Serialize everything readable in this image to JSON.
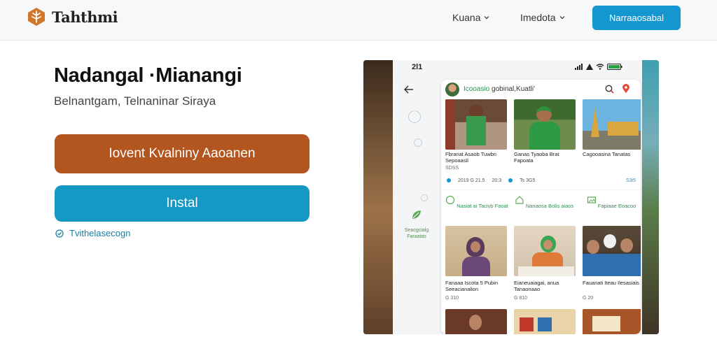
{
  "nav": {
    "brand": "Tahthmi",
    "menu_1": "Kuana",
    "menu_2": "Imedota",
    "cta": "Narraaosabal"
  },
  "hero": {
    "title": "Nadangal ·Mianangi",
    "subtitle": "Belnantgam, Telnaninar Siraya",
    "primary_button": "Iovent Kvalniny Aaoanen",
    "install_button": "Instal",
    "verified_text": "Tvithelasecogn"
  },
  "phone": {
    "status_time": "2l1",
    "app_title_green": "Icooasio",
    "app_title_dark": "gobinal,Kuatli'",
    "rail_fav_label": "Seacgcialg Faraatas",
    "row1": [
      {
        "caption": "Fbranat Asaob Tuwbn Sepoaasil",
        "meta": "SDSS"
      },
      {
        "caption": "Ganas Tyaoba Brat Fapoata",
        "meta": ""
      },
      {
        "caption": "Cagooasina Tanatas",
        "meta": ""
      }
    ],
    "row1_meta": [
      "2019 G 21.5",
      "20:3",
      "Ts 3G5",
      "S3i5"
    ],
    "categories": [
      "Nasiat ai Tacivb Faoat",
      "Nanaosa Bolis aiaos",
      "Fapiaae Eoacoo"
    ],
    "row2": [
      {
        "caption": "Fanaaa Iscota 5 Pubin Seeacianalion",
        "meta": "G 310"
      },
      {
        "caption": "Eianeuaiagai, anua Tanaonaao",
        "meta": "G 810"
      },
      {
        "caption": "Fauanati Iteau Ilesasiais",
        "meta": "G 20"
      }
    ]
  },
  "colors": {
    "cta_blue": "#1497d0",
    "primary_brown": "#b3551f",
    "install_teal": "#1598c4",
    "accent_green": "#2f8f52"
  }
}
